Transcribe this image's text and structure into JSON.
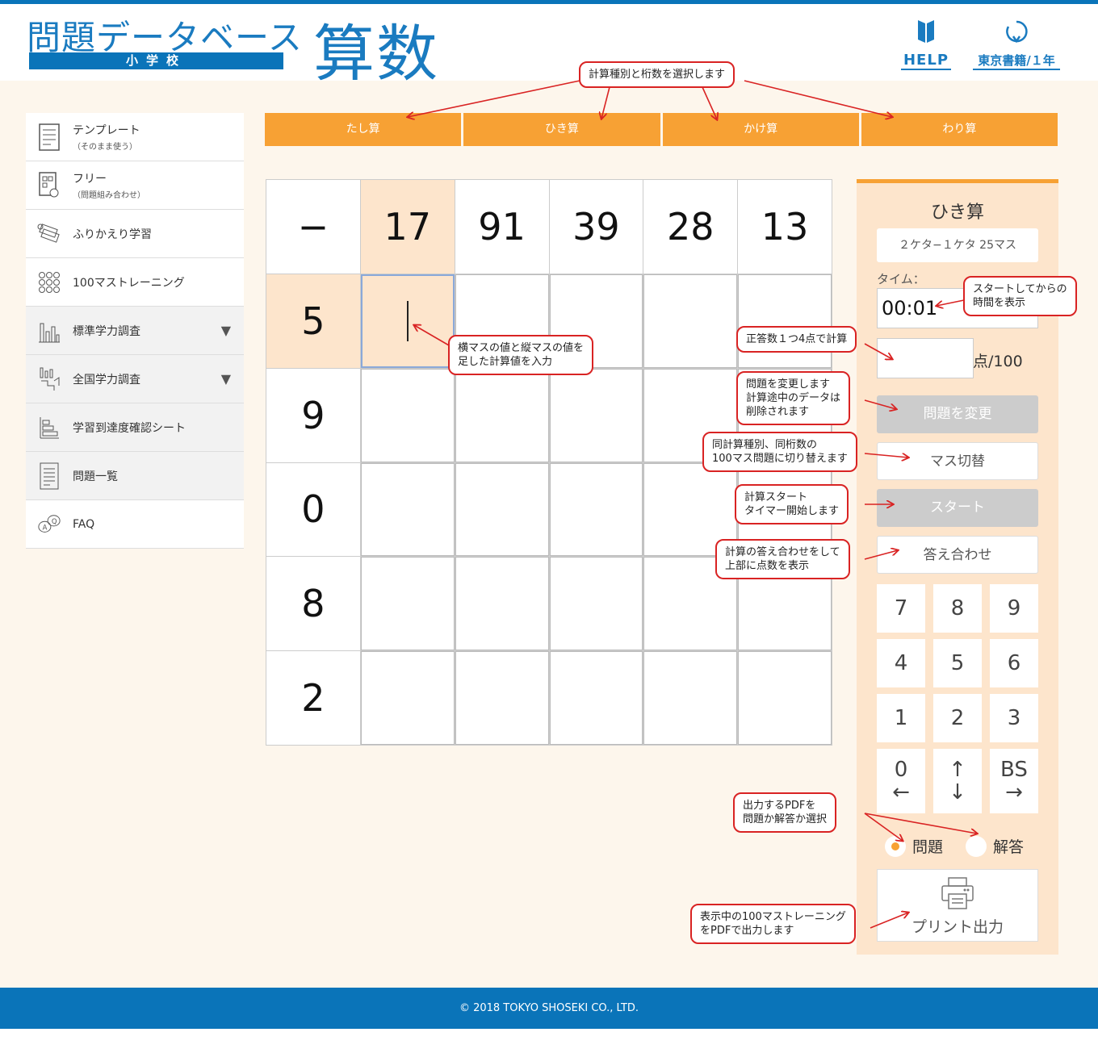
{
  "header": {
    "logo_title": "問題データベース",
    "logo_sub": "小学校",
    "subject": "算数",
    "help_label": "HELP",
    "publisher_label": "東京書籍/１年"
  },
  "sidebar": {
    "items": [
      {
        "label": "テンプレート",
        "sub": "（そのまま使う）"
      },
      {
        "label": "フリー",
        "sub": "（問題組み合わせ）"
      },
      {
        "label": "ふりかえり学習",
        "sub": ""
      },
      {
        "label": "100マストレーニング",
        "sub": ""
      },
      {
        "label": "標準学力調査",
        "sub": ""
      },
      {
        "label": "全国学力調査",
        "sub": ""
      },
      {
        "label": "学習到達度確認シート",
        "sub": ""
      },
      {
        "label": "問題一覧",
        "sub": ""
      },
      {
        "label": "FAQ",
        "sub": ""
      }
    ]
  },
  "tabs": [
    "たし算",
    "ひき算",
    "かけ算",
    "わり算"
  ],
  "grid": {
    "operator": "−",
    "top": [
      "17",
      "91",
      "39",
      "28",
      "13"
    ],
    "left": [
      "5",
      "9",
      "0",
      "8",
      "2"
    ]
  },
  "panel": {
    "title": "ひき算",
    "type": "２ケタ−１ケタ 25マス",
    "time_label": "タイム：",
    "time": "00:01",
    "score_unit": "点/100",
    "change_button": "問題を変更",
    "switch_button": "マス切替",
    "start_button": "スタート",
    "check_button": "答え合わせ",
    "keypad": [
      {
        "main": "7",
        "sub": ""
      },
      {
        "main": "8",
        "sub": ""
      },
      {
        "main": "9",
        "sub": ""
      },
      {
        "main": "4",
        "sub": ""
      },
      {
        "main": "5",
        "sub": ""
      },
      {
        "main": "6",
        "sub": ""
      },
      {
        "main": "1",
        "sub": ""
      },
      {
        "main": "2",
        "sub": ""
      },
      {
        "main": "3",
        "sub": ""
      },
      {
        "main": "0",
        "sub": "←"
      },
      {
        "main": "↑",
        "sub": "↓"
      },
      {
        "main": "BS",
        "sub": "→"
      }
    ],
    "radio_problem": "問題",
    "radio_answer": "解答",
    "print_button": "プリント出力"
  },
  "callouts": {
    "tabs": "計算種別と桁数を選択します",
    "cell": "横マスの値と縦マスの値を\n足した計算値を入力",
    "time": "スタートしてからの\n時間を表示",
    "score": "正答数１つ4点で計算",
    "change": "問題を変更します\n計算途中のデータは\n削除されます",
    "switch": "同計算種別、同桁数の\n100マス問題に切り替えます",
    "start": "計算スタート\nタイマー開始します",
    "check": "計算の答え合わせをして\n上部に点数を表示",
    "pdf": "出力するPDFを\n問題か解答か選択",
    "print": "表示中の100マストレーニング\nをPDFで出力します"
  },
  "footer": {
    "copyright": "© 2018 TOKYO SHOSEKI CO., LTD."
  }
}
